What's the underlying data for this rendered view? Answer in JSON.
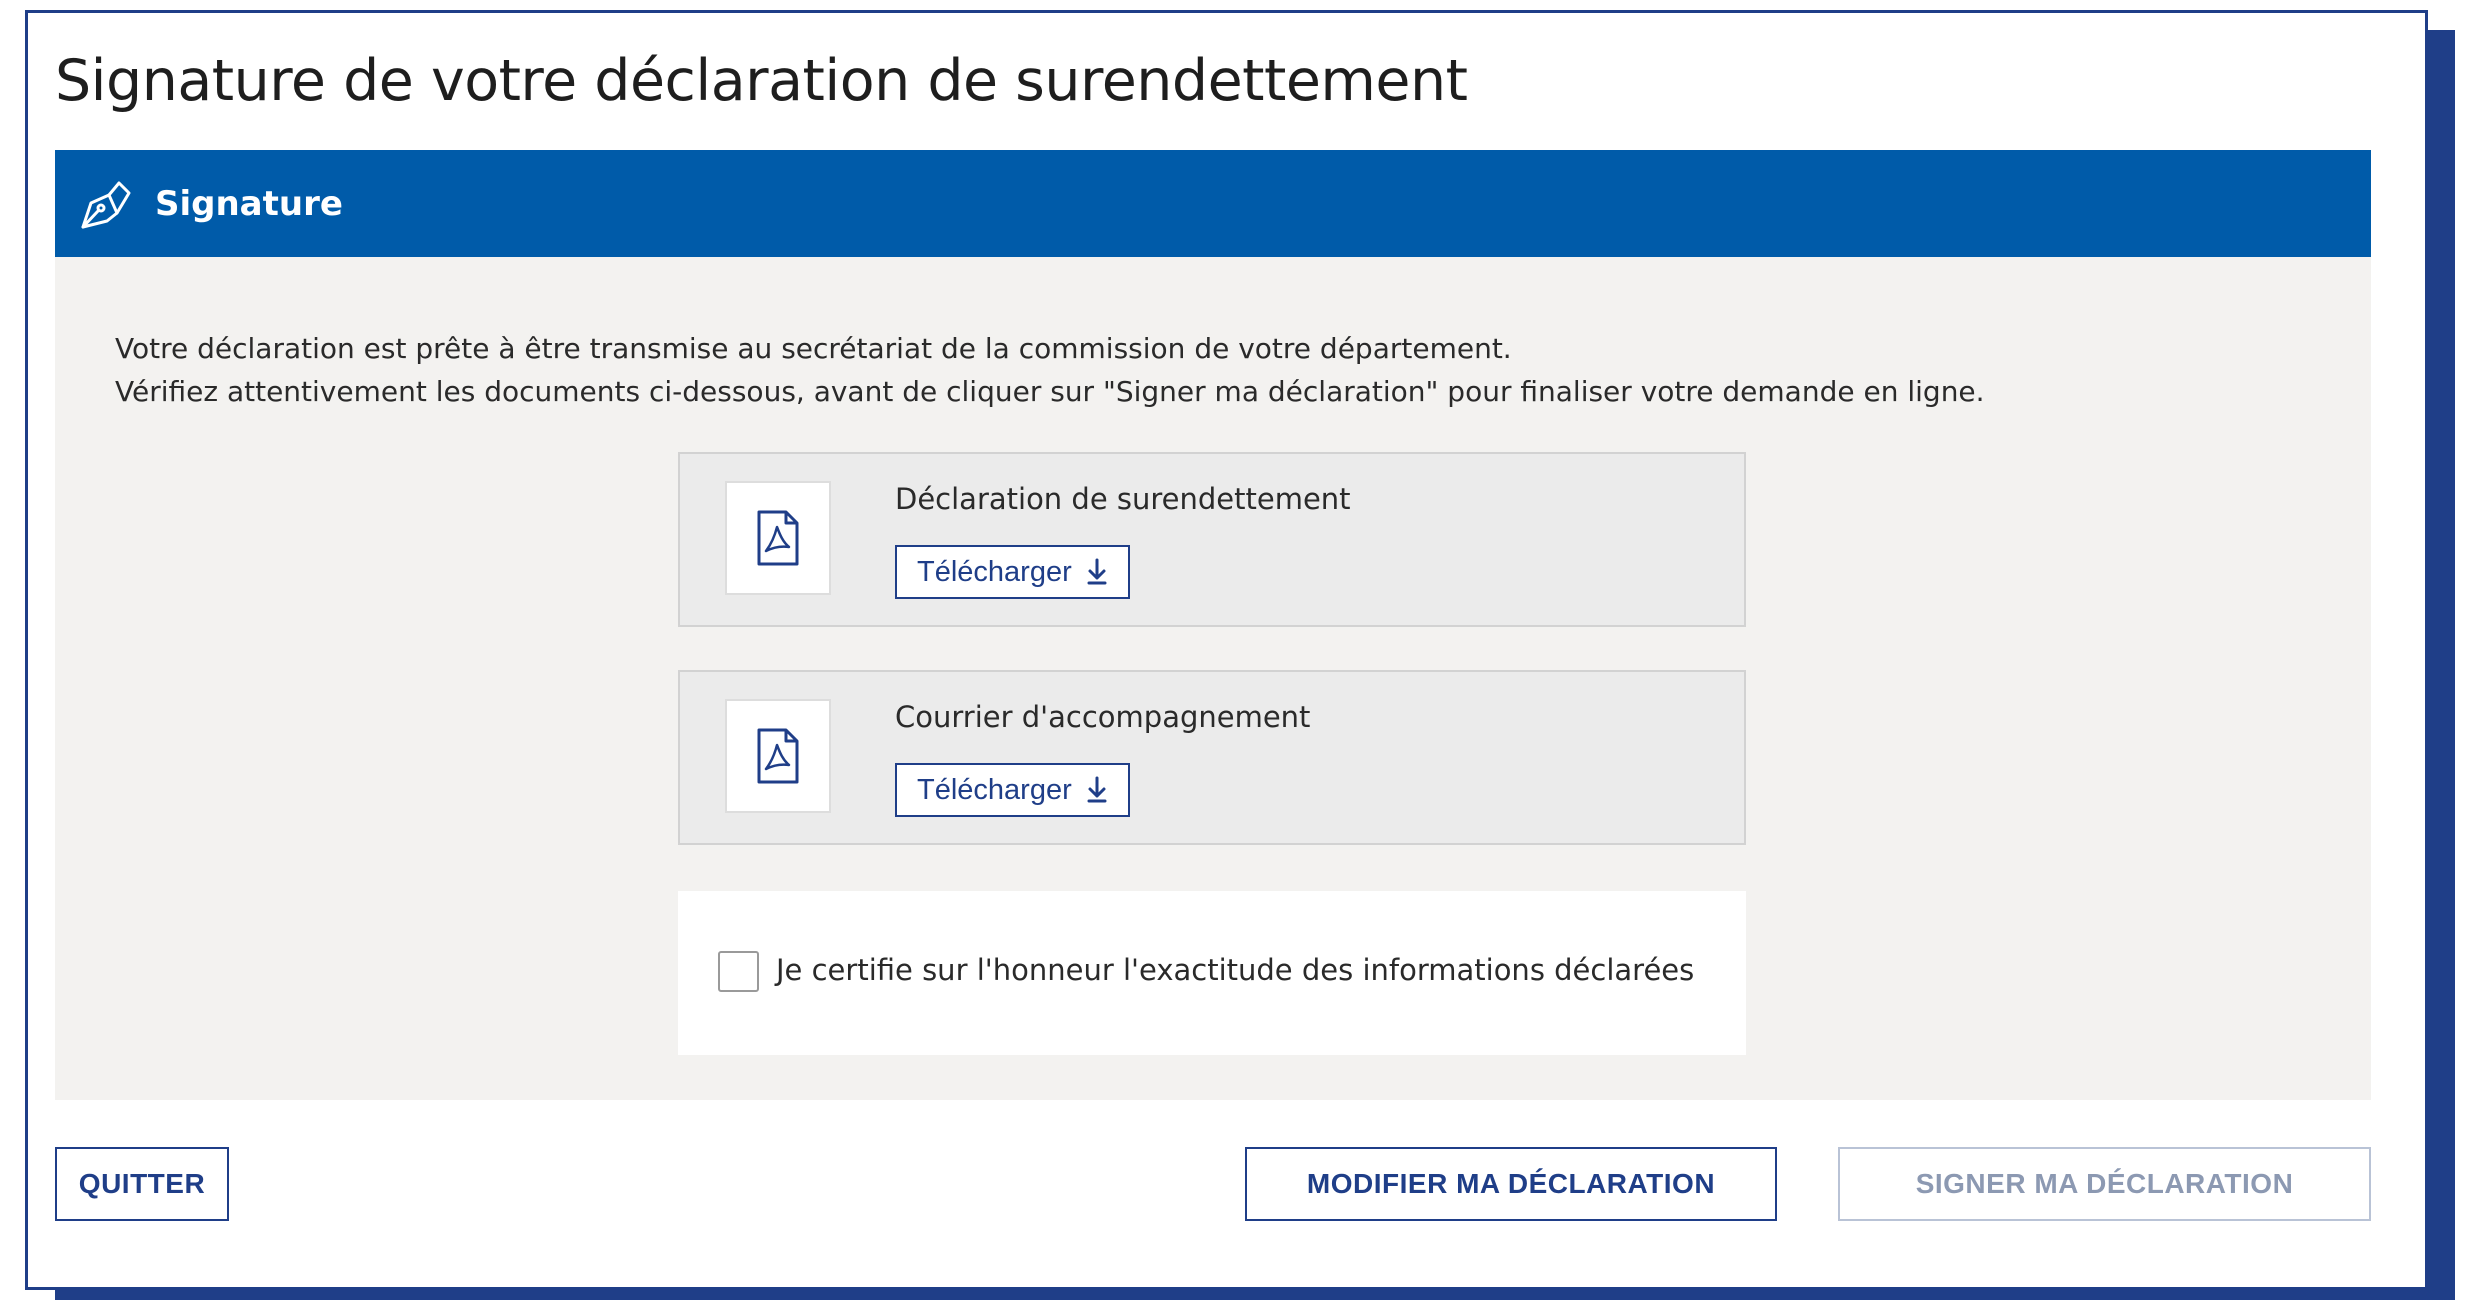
{
  "page": {
    "title": "Signature de votre déclaration de surendettement"
  },
  "section": {
    "title": "Signature",
    "icon": "pen-nib-icon"
  },
  "intro": {
    "line1": "Votre déclaration est prête à être transmise au secrétariat de la commission de votre département.",
    "line2": "Vérifiez attentivement les documents ci-dessous, avant de cliquer sur \"Signer ma déclaration\" pour finaliser votre demande en ligne."
  },
  "documents": [
    {
      "name": "Déclaration de surendettement",
      "icon": "pdf-file-icon",
      "download_label": "Télécharger"
    },
    {
      "name": "Courrier d'accompagnement",
      "icon": "pdf-file-icon",
      "download_label": "Télécharger"
    }
  ],
  "certification": {
    "label": "Je certifie sur l'honneur l'exactitude des informations déclarées",
    "checked": false
  },
  "footer": {
    "quit_label": "QUITTER",
    "modify_label": "MODIFIER MA DÉCLARATION",
    "sign_label": "SIGNER MA DÉCLARATION"
  },
  "colors": {
    "header_blue": "#005ba9",
    "navy": "#1f3e88",
    "panel_grey": "#f3f2f0",
    "disabled": "#8c99b2"
  }
}
